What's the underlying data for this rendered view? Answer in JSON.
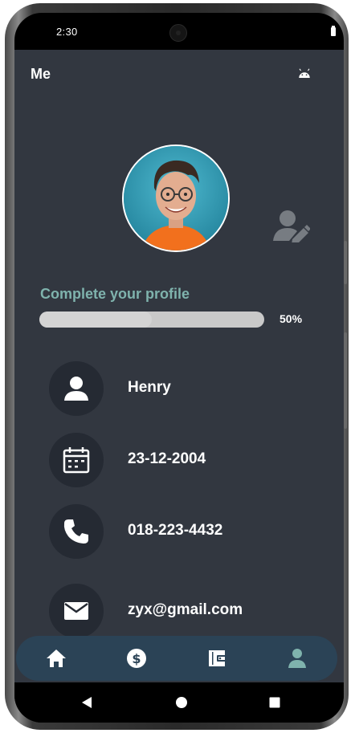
{
  "status_bar": {
    "time": "2:30"
  },
  "app_bar": {
    "title": "Me"
  },
  "profile_progress": {
    "title": "Complete your profile",
    "percent_label": "50%",
    "value": 0.5
  },
  "info_items": [
    {
      "icon": "person-icon",
      "text": "Henry"
    },
    {
      "icon": "calendar-icon",
      "text": "23-12-2004"
    },
    {
      "icon": "phone-icon",
      "text": "018-223-4432"
    },
    {
      "icon": "mail-icon",
      "text": "zyx@gmail.com"
    }
  ],
  "bottom_nav": {
    "items": [
      "home-icon",
      "dollar-icon",
      "wallet-icon",
      "profile-icon"
    ],
    "active_index": 3
  },
  "colors": {
    "background": "#323740",
    "icon_circle": "#252a33",
    "accent_text": "#7fb3ad",
    "nav_bar": "#2b4356",
    "nav_active": "#7fb3ad"
  }
}
